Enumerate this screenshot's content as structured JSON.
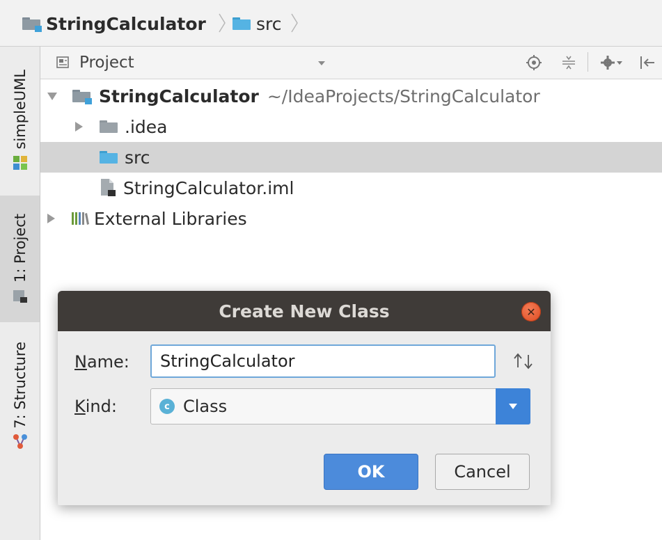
{
  "breadcrumb": {
    "items": [
      {
        "label": "StringCalculator",
        "icon": "project-folder-icon"
      },
      {
        "label": "src",
        "icon": "source-folder-icon"
      }
    ]
  },
  "tool_strip": {
    "tabs": [
      {
        "label": "simpleUML",
        "icon": "simpleuml-icon",
        "active": false
      },
      {
        "label": "1: Project",
        "icon": "project-icon",
        "active": true
      },
      {
        "label": "7: Structure",
        "icon": "structure-icon",
        "active": false
      }
    ]
  },
  "project_panel": {
    "view_label": "Project",
    "icons": [
      "locate-icon",
      "collapse-icon",
      "settings-icon",
      "hide-icon"
    ]
  },
  "tree": {
    "root": {
      "name": "StringCalculator",
      "path": "~/IdeaProjects/StringCalculator"
    },
    "items": [
      {
        "label": ".idea",
        "type": "folder"
      },
      {
        "label": "src",
        "type": "source-folder",
        "selected": true
      },
      {
        "label": "StringCalculator.iml",
        "type": "module-file"
      },
      {
        "label": "External Libraries",
        "type": "libraries"
      }
    ]
  },
  "dialog": {
    "title": "Create New Class",
    "name_label": "Name:",
    "name_mnemonic": "N",
    "name_rest": "ame:",
    "name_value": "StringCalculator",
    "sort_icon": "up-down-arrows-icon",
    "kind_label": "Kind:",
    "kind_mnemonic": "K",
    "kind_rest": "ind:",
    "kind_value": "Class",
    "kind_icon_letter": "c",
    "ok_label": "OK",
    "cancel_label": "Cancel",
    "colors": {
      "title_bar": "#3f3b38",
      "primary_button": "#4c8bdb",
      "close_button": "#e4562a"
    }
  }
}
